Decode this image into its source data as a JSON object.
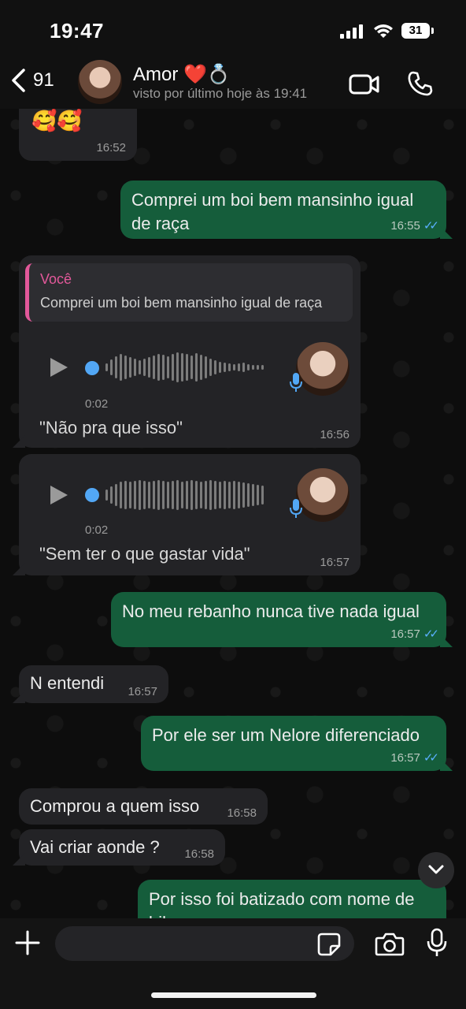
{
  "status_bar": {
    "time": "19:47",
    "battery": "31"
  },
  "header": {
    "back_count": "91",
    "contact_name": "Amor ❤️💍",
    "contact_status": "visto por último hoje às 19:41"
  },
  "messages": {
    "m0": {
      "emoji": "🥰🥰",
      "time": "16:52"
    },
    "m1": {
      "text": "Comprei um boi bem mansinho igual de raça",
      "time": "16:55"
    },
    "m2": {
      "quote_name": "Você",
      "quote_text": "Comprei um boi bem mansinho igual de raça",
      "duration": "0:02",
      "transcript": "\"Não pra que isso\"",
      "time": "16:56"
    },
    "m3": {
      "duration": "0:02",
      "transcript": "\"Sem ter o que gastar vida\"",
      "time": "16:57"
    },
    "m4": {
      "text": "No meu rebanho nunca tive nada igual",
      "time": "16:57"
    },
    "m5": {
      "text": "N entendi",
      "time": "16:57"
    },
    "m6": {
      "text": "Por ele ser um Nelore diferenciado",
      "time": "16:57"
    },
    "m7": {
      "text": "Comprou a quem isso",
      "time": "16:58"
    },
    "m8": {
      "text": "Vai criar aonde ?",
      "time": "16:58"
    },
    "m9": {
      "text": "Por isso foi batizado com nome de bilau"
    }
  },
  "input": {
    "placeholder": ""
  },
  "colors": {
    "outgoing": "#155d3b",
    "incoming": "#232326",
    "tick_blue": "#5ab0ff",
    "reply_accent": "#e2589a"
  },
  "icons": [
    "chevron-left-icon",
    "video-icon",
    "phone-icon",
    "play-icon",
    "mic-icon",
    "chevron-down-icon",
    "plus-icon",
    "sticker-icon",
    "camera-icon"
  ]
}
